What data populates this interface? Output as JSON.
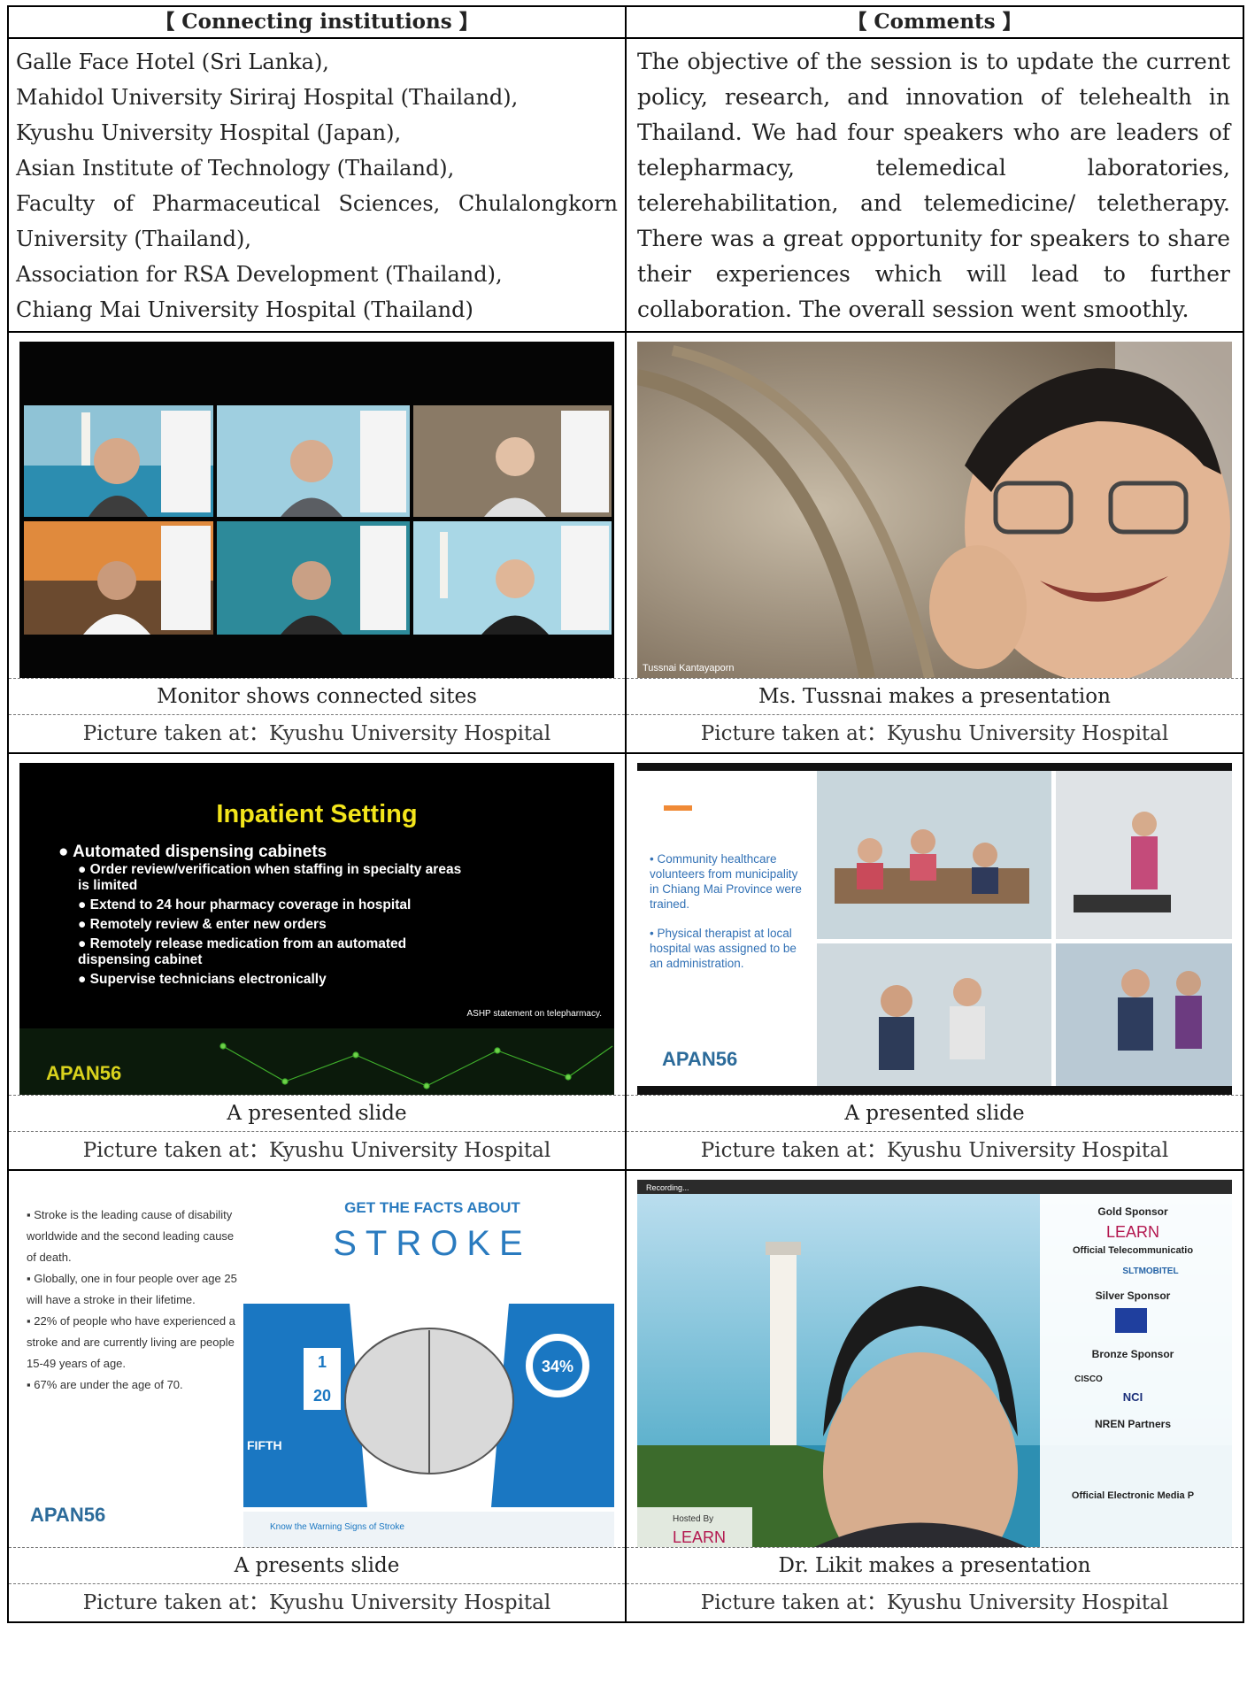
{
  "header": {
    "left": "【 Connecting institutions 】",
    "right": "【 Comments 】"
  },
  "institutions": [
    "Galle Face Hotel (Sri Lanka),",
    "Mahidol University Siriraj Hospital (Thailand),",
    "Kyushu University Hospital (Japan),",
    "Asian Institute of Technology (Thailand),",
    "Faculty of Pharmaceutical Sciences, Chulalongkorn University (Thailand),",
    "Association for RSA Development (Thailand),",
    "Chiang Mai University Hospital (Thailand)"
  ],
  "comments": "The objective of the session is to update the current policy, research, and innovation of telehealth in Thailand. We had four speakers who are leaders of telepharmacy, telemedical laboratories, telerehabilitation, and telemedicine/ teletherapy. There was a great opportunity for speakers to share their experiences which will lead to further collaboration. The overall session went smoothly.",
  "photos": [
    {
      "caption": "Monitor shows connected sites",
      "location": "Picture taken at：Kyushu University Hospital"
    },
    {
      "caption": "Ms. Tussnai makes a presentation",
      "location": "Picture taken at：Kyushu University Hospital",
      "name_tag": "Tussnai Kantayaporn"
    },
    {
      "caption": "A presented slide",
      "location": "Picture taken at：Kyushu University Hospital"
    },
    {
      "caption": "A presented slide",
      "location": "Picture taken at：Kyushu University Hospital"
    },
    {
      "caption": "A presents slide",
      "location": "Picture taken at：Kyushu University Hospital"
    },
    {
      "caption": "Dr. Likit makes a presentation",
      "location": "Picture taken at：Kyushu University Hospital"
    }
  ],
  "slide1": {
    "title": "Inpatient Setting",
    "bullet": "Automated dispensing cabinets",
    "subbullets": [
      "Order review/verification when staffing in specialty areas is limited",
      "Extend to 24 hour pharmacy coverage in hospital",
      "Remotely review & enter new orders",
      "Remotely release medication from an automated dispensing cabinet",
      "Supervise technicians electronically"
    ],
    "source": "ASHP statement on telepharmacy.",
    "logo": "APAN56"
  },
  "slide2": {
    "bullets": [
      "Community healthcare volunteers from municipality in Chiang Mai Province were trained.",
      "Physical therapist at local hospital was assigned to be an administration."
    ],
    "logo": "APAN56"
  },
  "slide3": {
    "bullets": [
      "Stroke is the leading cause of disability worldwide and the second leading cause of death.",
      "Globally, one in four people over age 25 will have a stroke in their lifetime.",
      "22% of people who have experienced a stroke and are currently living are people 15-49 years of age.",
      "67% are under the age of 70."
    ],
    "heading": "GET THE FACTS ABOUT",
    "big": "STROKE",
    "stat_pct": "34%",
    "stat_frac_top": "1",
    "stat_frac_bottom": "20",
    "fifth": "FIFTH",
    "warning": "Know the Warning Signs of Stroke",
    "logo": "APAN56"
  },
  "sponsors": {
    "gold": "Gold Sponsor",
    "learn": "LEARN",
    "telecom": "Official Telecommunicatio",
    "slt": "SLTMOBITEL",
    "silver": "Silver Sponsor",
    "bronze": "Bronze Sponsor",
    "cisco": "CISCO",
    "nci": "NCI",
    "nren": "NREN Partners",
    "media": "Official Electronic Media P",
    "hosted": "Hosted By",
    "hosted_learn": "LEARN",
    "recording": "Recording..."
  }
}
